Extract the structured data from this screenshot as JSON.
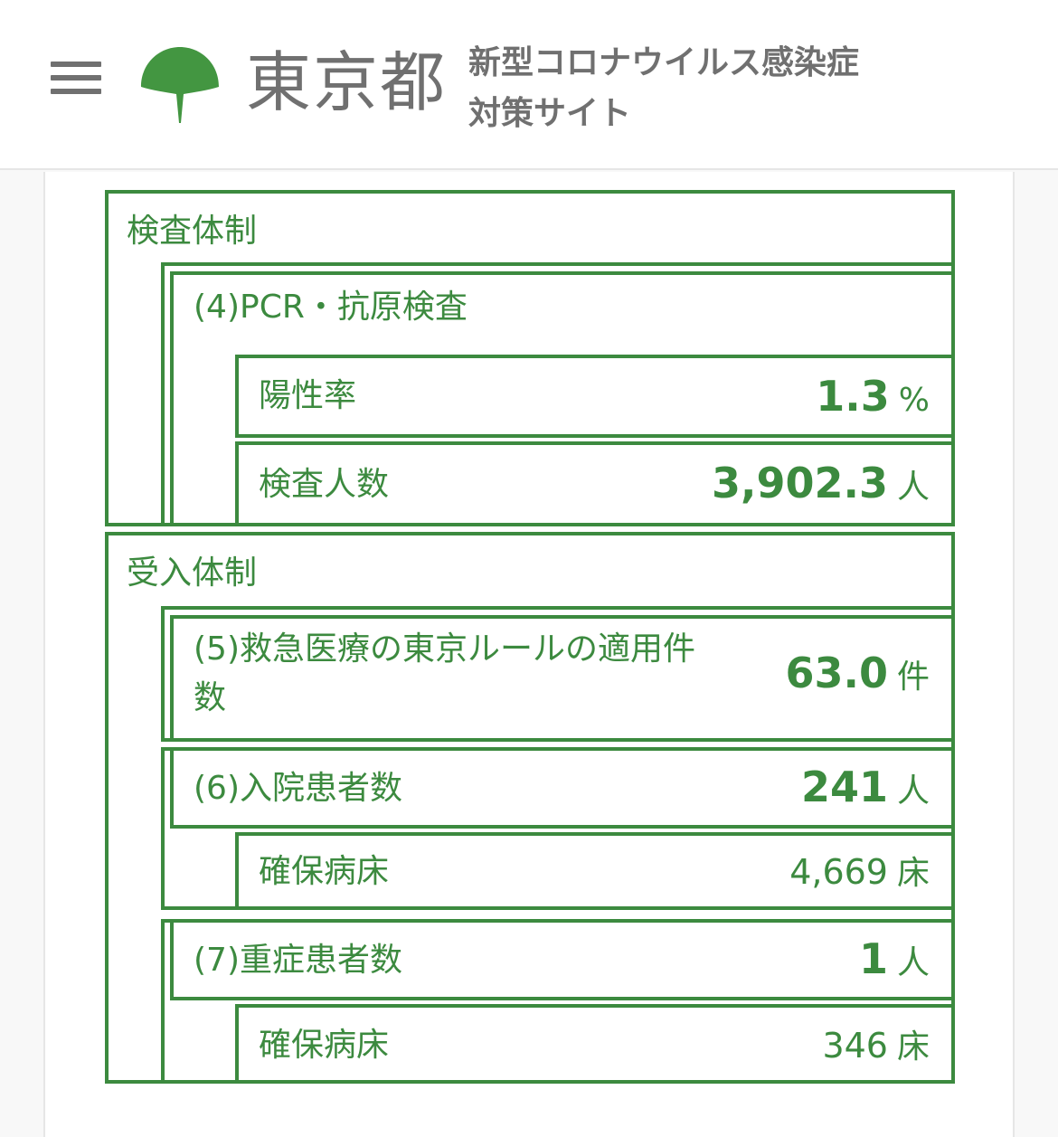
{
  "header": {
    "logo_text": "東京都",
    "site_title_line1": "新型コロナウイルス感染症",
    "site_title_line2": "対策サイト"
  },
  "colors": {
    "accent": "#3c8a3f",
    "logo_green": "#439641",
    "header_text": "#707070"
  },
  "testing": {
    "section_label": "検査体制",
    "pcr": {
      "label": "(4)PCR・抗原検査",
      "positive_rate": {
        "label": "陽性率",
        "value": "1.3",
        "unit": "%"
      },
      "tested": {
        "label": "検査人数",
        "value": "3,902.3",
        "unit": "人"
      }
    }
  },
  "reception": {
    "section_label": "受入体制",
    "emergency": {
      "label_line1": "(5)救急医療の東京ルールの適用件",
      "label_line2": "数",
      "value": "63.0",
      "unit": "件"
    },
    "hospitalized": {
      "label": "(6)入院患者数",
      "value": "241",
      "unit": "人",
      "beds": {
        "label": "確保病床",
        "value": "4,669",
        "unit": "床"
      }
    },
    "severe": {
      "label": "(7)重症患者数",
      "value": "1",
      "unit": "人",
      "beds": {
        "label": "確保病床",
        "value": "346",
        "unit": "床"
      }
    }
  }
}
